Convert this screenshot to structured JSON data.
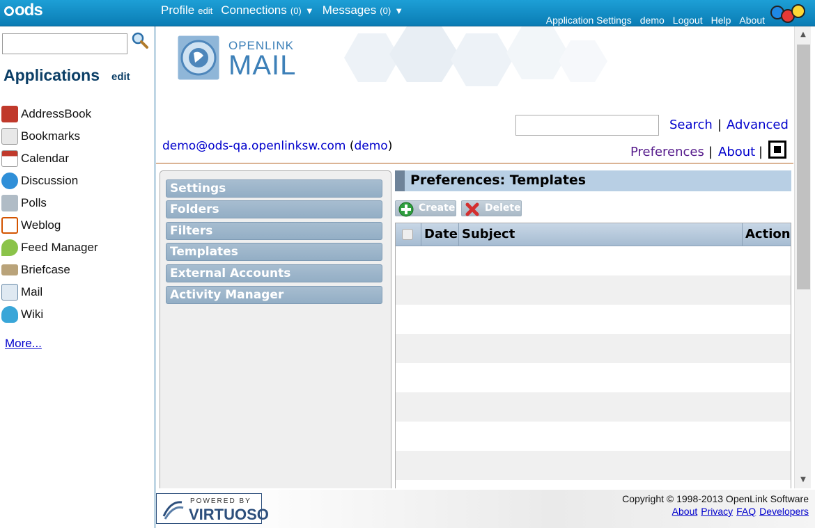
{
  "topbar": {
    "logo": "ods",
    "nav": [
      {
        "label": "Profile",
        "sub": "edit",
        "arrow": ""
      },
      {
        "label": "Connections",
        "sub": "(0)",
        "arrow": "▼"
      },
      {
        "label": "Messages",
        "sub": "(0)",
        "arrow": "▼"
      }
    ],
    "links": [
      "Application Settings",
      "demo",
      "Logout",
      "Help",
      "About"
    ]
  },
  "sidebar": {
    "search_value": "",
    "title": "Applications",
    "edit": "edit",
    "apps": [
      {
        "label": "AddressBook",
        "icon": "addressbook-icon"
      },
      {
        "label": "Bookmarks",
        "icon": "bookmarks-icon"
      },
      {
        "label": "Calendar",
        "icon": "calendar-icon"
      },
      {
        "label": "Discussion",
        "icon": "discussion-icon"
      },
      {
        "label": "Polls",
        "icon": "polls-icon"
      },
      {
        "label": "Weblog",
        "icon": "weblog-icon"
      },
      {
        "label": "Feed Manager",
        "icon": "feed-icon"
      },
      {
        "label": "Briefcase",
        "icon": "briefcase-icon"
      },
      {
        "label": "Mail",
        "icon": "mail-icon"
      },
      {
        "label": "Wiki",
        "icon": "wiki-icon"
      }
    ],
    "more": "More..."
  },
  "main": {
    "logo_top": "OPENLINK",
    "logo_bottom": "MAIL",
    "search_value": "",
    "search_link": "Search",
    "separator": "|",
    "advanced_link": "Advanced",
    "user_email": "demo@ods-qa.openlinksw.com",
    "user_name": "demo",
    "preferences_link": "Preferences",
    "about_link": "About",
    "pref_nav": [
      "Settings",
      "Folders",
      "Filters",
      "Templates",
      "External Accounts",
      "Activity Manager"
    ],
    "content_title": "Preferences: Templates",
    "create_button": "Create",
    "delete_button": "Delete",
    "columns": [
      "Date",
      "Subject",
      "Action"
    ]
  },
  "footer": {
    "powered": "POWERED BY",
    "virtuoso": "VIRTUOSO",
    "copyright": "Copyright © 1998-2013 OpenLink Software",
    "links": [
      "About",
      "Privacy",
      "FAQ",
      "Developers"
    ]
  },
  "colors": {
    "topbar": "#0a7cb4",
    "title_text": "#0b3e66",
    "link": "#0000cc",
    "nav_button": "#93aec5"
  }
}
